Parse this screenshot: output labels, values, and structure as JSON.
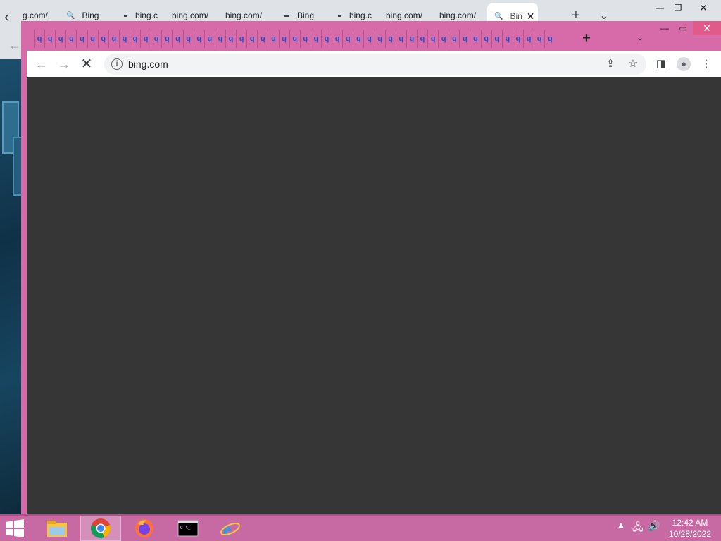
{
  "back_browser": {
    "tabs": [
      {
        "label": "g.com/",
        "icon": "none"
      },
      {
        "label": "Bing",
        "icon": "search-icon"
      },
      {
        "label": "bing.c",
        "icon": "dot"
      },
      {
        "label": "bing.com/",
        "icon": "none"
      },
      {
        "label": "bing.com/",
        "icon": "none"
      },
      {
        "label": "Bing",
        "icon": "dot"
      },
      {
        "label": "bing.c",
        "icon": "dot"
      },
      {
        "label": "bing.com/",
        "icon": "none"
      },
      {
        "label": "bing.com/",
        "icon": "none"
      },
      {
        "label": "Bin",
        "icon": "search-icon",
        "active": true
      }
    ],
    "new_tab": "+",
    "scroll_left": "‹",
    "dropdown": "⌄"
  },
  "front_browser": {
    "mini_tab_icon": "search-icon",
    "mini_tab_count": 49,
    "new_tab": "+",
    "dropdown": "⌄",
    "address": {
      "url": "bing.com"
    },
    "content_bg": "#363636",
    "frame_color": "#d76aa8"
  },
  "taskbar": {
    "items": [
      "file-explorer-icon",
      "chrome-icon",
      "firefox-icon",
      "cmd-icon",
      "ie-icon"
    ],
    "clock": {
      "time": "12:42 AM",
      "date": "10/28/2022"
    }
  }
}
